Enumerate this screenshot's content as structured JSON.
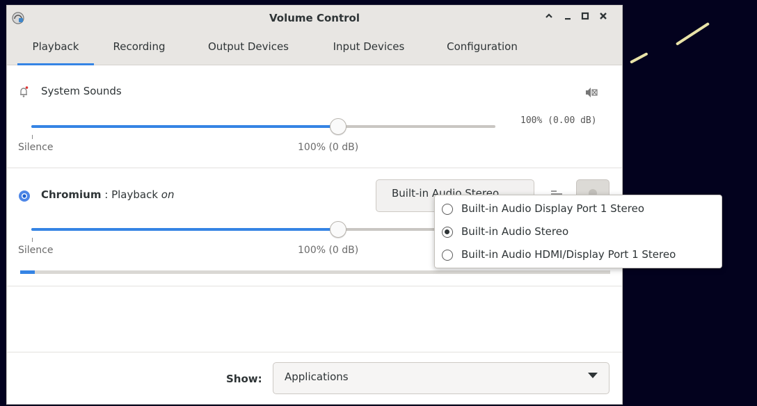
{
  "window": {
    "title": "Volume Control",
    "controls": {
      "minimize": "_",
      "maximize": "□",
      "close": "✕",
      "shade": "^"
    }
  },
  "tabs": [
    {
      "label": "Playback",
      "active": true
    },
    {
      "label": "Recording"
    },
    {
      "label": "Output Devices"
    },
    {
      "label": "Input Devices"
    },
    {
      "label": "Configuration"
    }
  ],
  "system_sounds": {
    "label": "System Sounds",
    "volume_text": "100% (0.00 dB)",
    "volume_fraction": 0.66,
    "tick_silence": "Silence",
    "tick_100": "100% (0 dB)"
  },
  "chromium": {
    "app_name": "Chromium",
    "separator": " : ",
    "playback_prefix": "Playback ",
    "playback_state": "on",
    "device_button": "Built-in Audio Stereo",
    "volume_fraction": 0.66,
    "tick_silence": "Silence",
    "tick_100": "100% (0 dB)",
    "level_fraction": 0.025
  },
  "footer": {
    "show_label": "Show:",
    "show_value": "Applications"
  },
  "device_popup": {
    "options": [
      {
        "label": "Built-in Audio Display Port 1 Stereo",
        "selected": false
      },
      {
        "label": "Built-in Audio Stereo",
        "selected": true
      },
      {
        "label": "Built-in Audio HDMI/Display Port 1 Stereo",
        "selected": false
      }
    ]
  },
  "colors": {
    "accent": "#3584e4",
    "desktop": "#03021e",
    "streak": "#e9e3a8"
  },
  "icons": [
    "volume-control-app-icon",
    "bell-icon",
    "speaker-muted-icon",
    "chromium-icon",
    "lock-channels-icon",
    "mute-icon"
  ]
}
